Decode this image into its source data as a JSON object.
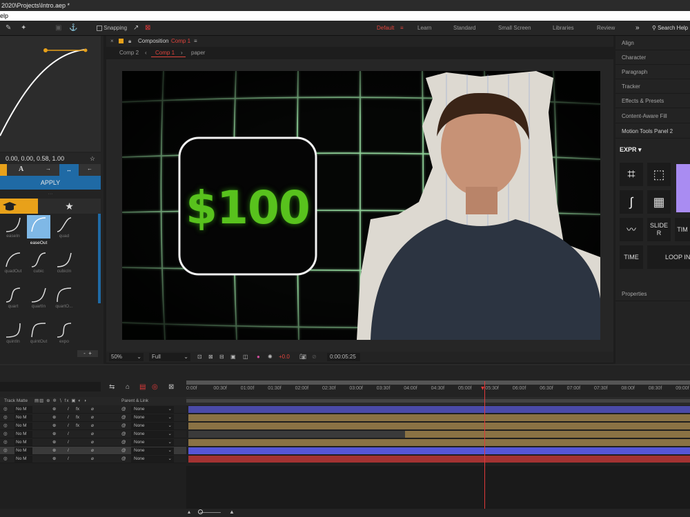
{
  "window": {
    "title": "2020\\Projects\\Intro.aep *"
  },
  "menubar": {
    "help": "elp"
  },
  "toolbar": {
    "snapping": "Snapping",
    "workspaces": [
      "Default",
      "Learn",
      "Standard",
      "Small Screen",
      "Libraries",
      "Review"
    ],
    "search_placeholder": "Search Help"
  },
  "easing_panel": {
    "values": "0.00, 0.00, 0.58, 1.00",
    "apply": "APPLY",
    "presets": [
      {
        "label": "easeIn"
      },
      {
        "label": "easeOut"
      },
      {
        "label": "quad"
      },
      {
        "label": "quadOut"
      },
      {
        "label": "cubic"
      },
      {
        "label": "cubicIn"
      },
      {
        "label": "quart"
      },
      {
        "label": "quartIn"
      },
      {
        "label": "quartO..."
      },
      {
        "label": "quintIn"
      },
      {
        "label": "quintOut"
      },
      {
        "label": "expo"
      }
    ],
    "selected": "easeOut",
    "accent": "#1f6aa5",
    "tab_color": "#e8a11a"
  },
  "composition": {
    "panel_label": "Composition",
    "name": "Comp 1",
    "breadcrumbs": [
      "Comp 2",
      "Comp 1",
      "paper"
    ],
    "price_text": "$100",
    "zoom": "50%",
    "resolution": "Full",
    "exposure": "+0.0",
    "timecode": "0:00:05:25"
  },
  "right_panel": {
    "items": [
      "Align",
      "Character",
      "Paragraph",
      "Tracker",
      "Effects & Presets",
      "Content-Aware Fill",
      "Motion Tools Panel 2"
    ],
    "expr": "EXPR",
    "buttons": {
      "slider": "SLIDE R",
      "time_short": "TIM",
      "time": "TIME",
      "loop": "LOOP IN"
    },
    "properties": "Properties"
  },
  "timeline": {
    "columns": {
      "trackmatte": "Track Matte",
      "parent": "Parent & Link"
    },
    "ruler": [
      "0:00f",
      "00:30f",
      "01:00f",
      "01:30f",
      "02:00f",
      "02:30f",
      "03:00f",
      "03:30f",
      "04:00f",
      "04:30f",
      "05:00f",
      "05:30f",
      "06:00f",
      "06:30f",
      "07:00f",
      "07:30f",
      "08:00f",
      "08:30f",
      "09:00f"
    ],
    "layers": [
      {
        "matte": "No M",
        "parent": "None",
        "bar_color": "#4a4aa8",
        "start": 0
      },
      {
        "matte": "No M",
        "parent": "None",
        "bar_color": "#8a7244",
        "start": 0
      },
      {
        "matte": "No M",
        "parent": "None",
        "bar_color": "#8a7244",
        "start": 0
      },
      {
        "matte": "No M",
        "parent": "None",
        "bar_color": "#8a7244",
        "start": 0.43
      },
      {
        "matte": "No M",
        "parent": "None",
        "bar_color": "#8a7244",
        "start": 0
      },
      {
        "matte": "No M",
        "parent": "None",
        "bar_color": "#5656d6",
        "start": 0
      },
      {
        "matte": "No M",
        "parent": "None",
        "bar_color": "#a33232",
        "start": 0
      }
    ]
  }
}
